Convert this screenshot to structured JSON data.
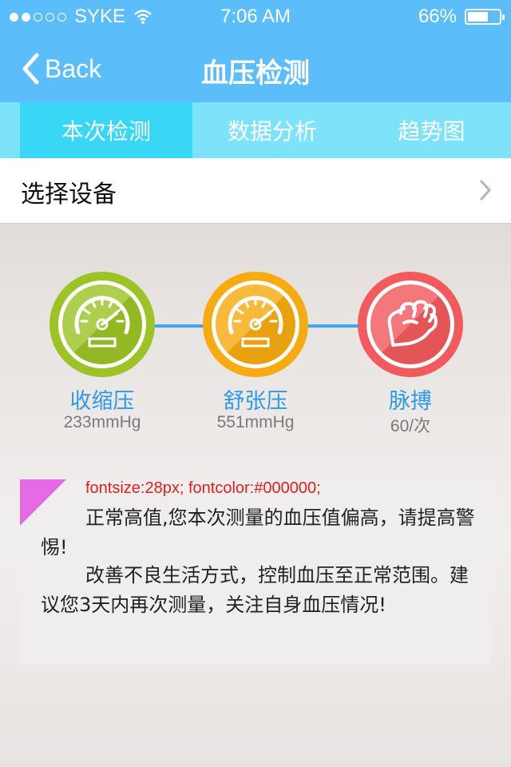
{
  "status_bar": {
    "carrier": "SYKE",
    "time": "7:06 AM",
    "battery": "66%",
    "battery_level": 0.66,
    "signal_bars_filled": 2,
    "signal_bars_total": 5
  },
  "nav": {
    "back_label": "Back",
    "title": "血压检测"
  },
  "tabs": [
    {
      "label": "本次检测",
      "active": true
    },
    {
      "label": "数据分析",
      "active": false
    },
    {
      "label": "趋势图",
      "active": false
    }
  ],
  "device": {
    "label": "选择设备"
  },
  "metrics": [
    {
      "label": "收缩压",
      "value": "233mmHg",
      "color": "#9cc426",
      "icon": "speedometer-icon"
    },
    {
      "label": "舒张压",
      "value": "551mmHg",
      "color": "#f6ab10",
      "icon": "speedometer-icon"
    },
    {
      "label": "脉搏",
      "value": "60/次",
      "color": "#f25a5e",
      "icon": "fist-icon"
    }
  ],
  "result": {
    "note": "fontsize:28px; fontcolor:#000000;",
    "paragraph1": "正常高值,您本次测量的血压值偏高，请提高警惕!",
    "paragraph2": "改善不良生活方式，控制血压至正常范围。建议您3天内再次测量，关注自身血压情况!"
  },
  "colors": {
    "accent": "#5bbdf9",
    "tab_bg": "#7fe2fb",
    "tab_active": "#3ad6f6",
    "label_blue": "#2e9ae6"
  }
}
